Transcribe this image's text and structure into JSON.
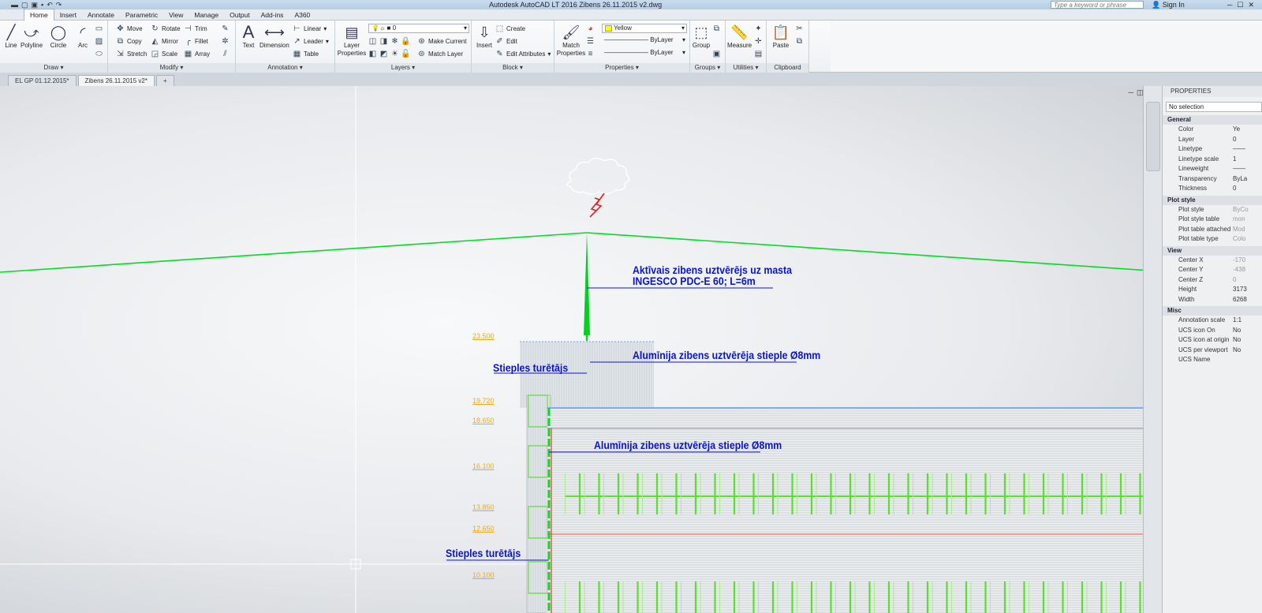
{
  "app": {
    "title": "Autodesk AutoCAD LT 2016    Zibens 26.11.2015 v2.dwg",
    "search_placeholder": "Type a keyword or phrase",
    "signin": "Sign In"
  },
  "menu_tabs": [
    "Home",
    "Insert",
    "Annotate",
    "Parametric",
    "View",
    "Manage",
    "Output",
    "Add-ins",
    "A360"
  ],
  "ribbon": {
    "draw": {
      "title": "Draw ▾",
      "line": "Line",
      "polyline": "Polyline",
      "circle": "Circle",
      "arc": "Arc"
    },
    "modify": {
      "title": "Modify ▾",
      "move": "Move",
      "rotate": "Rotate",
      "trim": "Trim",
      "copy": "Copy",
      "mirror": "Mirror",
      "fillet": "Fillet",
      "stretch": "Stretch",
      "scale": "Scale",
      "array": "Array"
    },
    "annotation": {
      "title": "Annotation ▾",
      "text": "Text",
      "dimension": "Dimension",
      "linear": "Linear",
      "leader": "Leader",
      "table": "Table"
    },
    "layers": {
      "title": "Layers ▾",
      "layer_properties": "Layer Properties",
      "current_layer": "0",
      "make_current": "Make Current",
      "match_layer": "Match Layer"
    },
    "block": {
      "title": "Block ▾",
      "insert": "Insert",
      "create": "Create",
      "edit": "Edit",
      "edit_attributes": "Edit Attributes"
    },
    "properties": {
      "title": "Properties ▾",
      "match_properties": "Match Properties",
      "color": "Yellow",
      "linetype": "ByLayer",
      "lineweight": "ByLayer"
    },
    "groups": {
      "title": "Groups ▾",
      "group": "Group"
    },
    "utilities": {
      "title": "Utilities ▾",
      "measure": "Measure"
    },
    "clipboard": {
      "title": "Clipboard",
      "paste": "Paste"
    }
  },
  "doc_tabs": [
    "EL GP 01.12.2015*",
    "Zibens 26.11.2015 v2*",
    "+"
  ],
  "drawing": {
    "annotations": {
      "air_terminal_1": "Aktīvais zibens uztvērējs uz masta",
      "air_terminal_2": "INGESCO PDC-E 60; L=6m",
      "rod_upper": "Alumīnija zibens uztvērēja stieple Ø8mm",
      "holder_upper": "Stieples turētājs",
      "rod_lower": "Alumīnija zibens uztvērēja stieple Ø8mm",
      "holder_lower": "Stieples turētājs"
    },
    "elevations": [
      "23.500",
      "19.720",
      "18.650",
      "16.100",
      "13.850",
      "12.650",
      "10.100"
    ]
  },
  "properties_palette": {
    "title": "PROPERTIES",
    "selection": "No selection",
    "sections": [
      {
        "name": "General",
        "rows": [
          [
            "Color",
            "Ye"
          ],
          [
            "Layer",
            "0"
          ],
          [
            "Linetype",
            "——"
          ],
          [
            "Linetype scale",
            "1"
          ],
          [
            "Lineweight",
            "——"
          ],
          [
            "Transparency",
            "ByLa"
          ],
          [
            "Thickness",
            "0"
          ]
        ]
      },
      {
        "name": "Plot style",
        "rows": [
          [
            "Plot style",
            "ByCo"
          ],
          [
            "Plot style table",
            "mon"
          ],
          [
            "Plot table attached to",
            "Mod"
          ],
          [
            "Plot table type",
            "Colo"
          ]
        ]
      },
      {
        "name": "View",
        "rows": [
          [
            "Center X",
            "-170"
          ],
          [
            "Center Y",
            "-438"
          ],
          [
            "Center Z",
            "0"
          ],
          [
            "Height",
            "3173"
          ],
          [
            "Width",
            "6268"
          ]
        ]
      },
      {
        "name": "Misc",
        "rows": [
          [
            "Annotation scale",
            "1:1"
          ],
          [
            "UCS icon On",
            "No"
          ],
          [
            "UCS icon at origin",
            "No"
          ],
          [
            "UCS per viewport",
            "No"
          ],
          [
            "UCS Name",
            ""
          ]
        ]
      }
    ]
  },
  "colors": {
    "accent_green": "#00dd22",
    "annotation_blue": "#0a14c8",
    "elevation_orange": "#f0a81a",
    "lightning_red": "#e02020"
  }
}
